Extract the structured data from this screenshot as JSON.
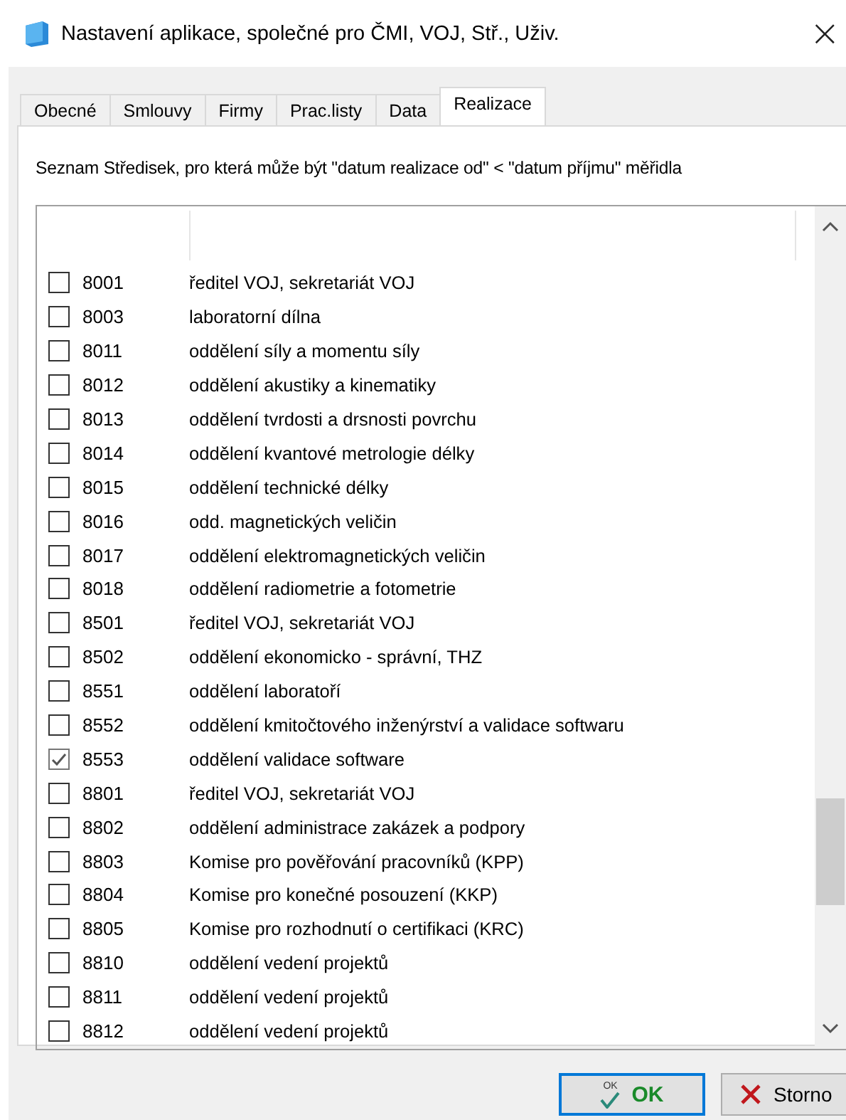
{
  "window": {
    "title": "Nastavení aplikace, společné pro ČMI, VOJ, Stř., Uživ.",
    "close": "×"
  },
  "tabs": [
    {
      "label": "Obecné",
      "selected": false
    },
    {
      "label": "Smlouvy",
      "selected": false
    },
    {
      "label": "Firmy",
      "selected": false
    },
    {
      "label": "Prac.listy",
      "selected": false
    },
    {
      "label": "Data",
      "selected": false
    },
    {
      "label": "Realizace",
      "selected": true
    }
  ],
  "description": "Seznam Středisek, pro která může být \"datum realizace od\" < \"datum příjmu\" měřidla",
  "list": {
    "rows": [
      {
        "code": "8001",
        "name": "ředitel VOJ, sekretariát VOJ",
        "checked": false
      },
      {
        "code": "8003",
        "name": "laboratorní dílna",
        "checked": false
      },
      {
        "code": "8011",
        "name": "oddělení síly a momentu síly",
        "checked": false
      },
      {
        "code": "8012",
        "name": "oddělení akustiky a kinematiky",
        "checked": false
      },
      {
        "code": "8013",
        "name": "oddělení tvrdosti a drsnosti povrchu",
        "checked": false
      },
      {
        "code": "8014",
        "name": "oddělení kvantové metrologie délky",
        "checked": false
      },
      {
        "code": "8015",
        "name": "oddělení technické délky",
        "checked": false
      },
      {
        "code": "8016",
        "name": "odd. magnetických veličin",
        "checked": false
      },
      {
        "code": "8017",
        "name": "oddělení elektromagnetických veličin",
        "checked": false
      },
      {
        "code": "8018",
        "name": "oddělení radiometrie a fotometrie",
        "checked": false
      },
      {
        "code": "8501",
        "name": "ředitel VOJ, sekretariát VOJ",
        "checked": false
      },
      {
        "code": "8502",
        "name": "oddělení ekonomicko - správní, THZ",
        "checked": false
      },
      {
        "code": "8551",
        "name": "oddělení laboratoří",
        "checked": false
      },
      {
        "code": "8552",
        "name": "oddělení kmitočtového inženýrství a validace softwaru",
        "checked": false
      },
      {
        "code": "8553",
        "name": "oddělení validace software",
        "checked": true
      },
      {
        "code": "8801",
        "name": "ředitel VOJ, sekretariát VOJ",
        "checked": false
      },
      {
        "code": "8802",
        "name": "oddělení administrace zakázek a podpory",
        "checked": false
      },
      {
        "code": "8803",
        "name": "Komise pro pověřování pracovníků (KPP)",
        "checked": false
      },
      {
        "code": "8804",
        "name": "Komise pro konečné posouzení (KKP)",
        "checked": false
      },
      {
        "code": "8805",
        "name": "Komise pro rozhodnutí o certifikaci (KRC)",
        "checked": false
      },
      {
        "code": "8810",
        "name": "oddělení vedení projektů",
        "checked": false
      },
      {
        "code": "8811",
        "name": "oddělení vedení projektů",
        "checked": false
      },
      {
        "code": "8812",
        "name": "oddělení vedení projektů",
        "checked": false
      }
    ]
  },
  "buttons": [
    {
      "label": "OK",
      "kind": "ok",
      "icon_text": "OK"
    },
    {
      "label": "Storno",
      "kind": "cancel"
    }
  ]
}
